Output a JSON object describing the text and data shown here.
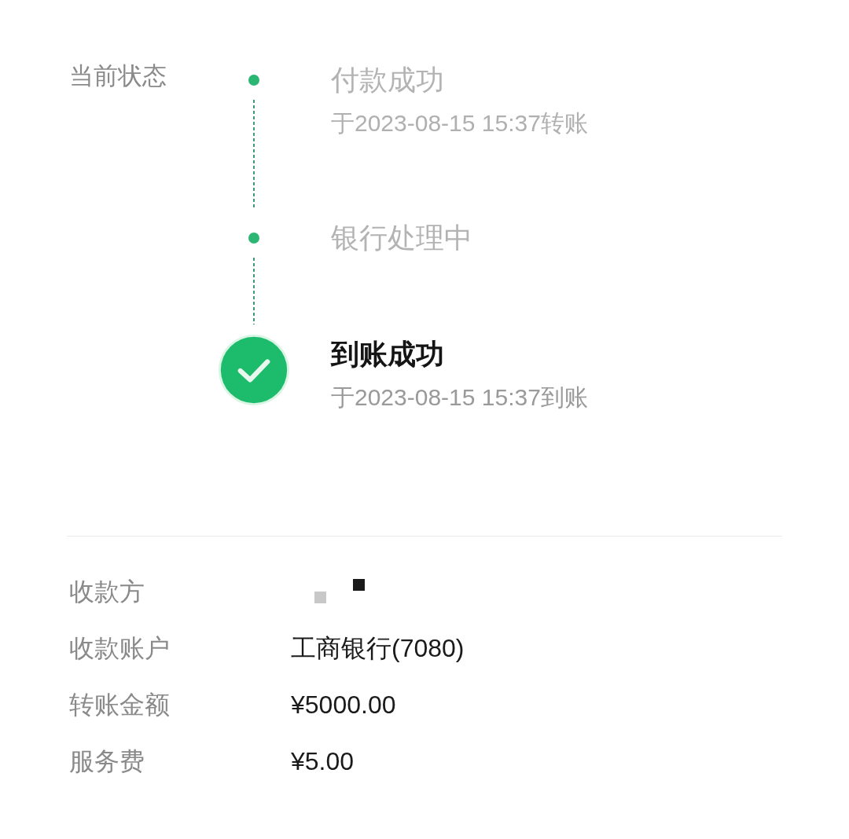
{
  "current_status": {
    "label": "当前状态",
    "steps": [
      {
        "title": "付款成功",
        "subtitle": "于2023-08-15 15:37转账",
        "current": false
      },
      {
        "title": "银行处理中",
        "current": false
      },
      {
        "title": "到账成功",
        "subtitle": "于2023-08-15 15:37到账",
        "current": true
      }
    ]
  },
  "details": [
    {
      "label": "收款方",
      "kind": "redacted"
    },
    {
      "label": "收款账户",
      "kind": "text",
      "value": "工商银行(7080)"
    },
    {
      "label": "转账金额",
      "kind": "text",
      "value": "¥5000.00"
    },
    {
      "label": "服务费",
      "kind": "text",
      "value": "¥5.00"
    }
  ]
}
